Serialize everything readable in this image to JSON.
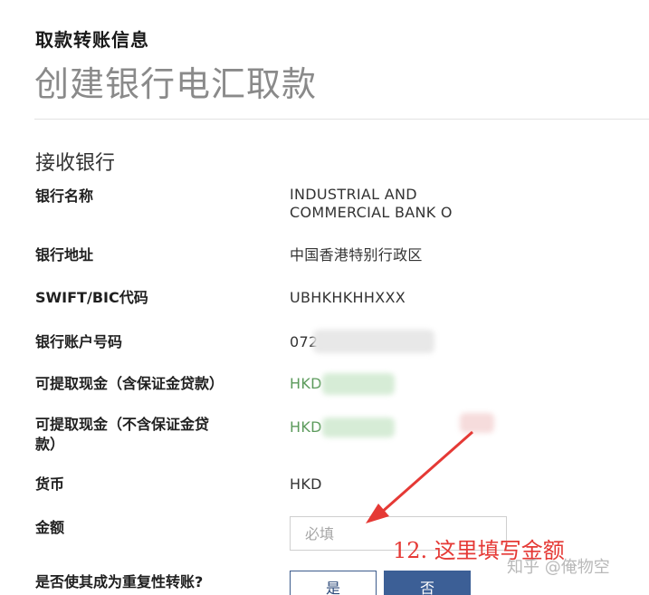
{
  "header": {
    "subtitle": "取款转账信息",
    "title": "创建银行电汇取款"
  },
  "section": {
    "title": "接收银行"
  },
  "rows": [
    {
      "label": "银行名称",
      "value": "INDUSTRIAL AND\nCOMMERCIAL BANK O"
    },
    {
      "label": "银行地址",
      "value": "中国香港特别行政区"
    },
    {
      "label": "SWIFT/BIC代码",
      "value": "UBHKHKHHXXX"
    },
    {
      "label": "银行账户号码",
      "value": "072"
    },
    {
      "label": "可提取现金（含保证金贷款）",
      "value": "HKD"
    },
    {
      "label": "可提取现金（不含保证金贷\n款）",
      "value": "HKD"
    },
    {
      "label": "货币",
      "value": "HKD"
    },
    {
      "label": "金额"
    },
    {
      "label": "是否使其成为重复性转账?"
    }
  ],
  "amount": {
    "placeholder": "必填",
    "value": ""
  },
  "recurring": {
    "yes_label": "是",
    "no_label": "否"
  },
  "annotation": {
    "text": "12. 这里填写金额",
    "color": "#e53935"
  },
  "watermark": {
    "text": "知乎 @俺物空"
  },
  "colors": {
    "accent": "#3c5f96",
    "green_value": "#5b9a5b",
    "annotation_red": "#e53935"
  }
}
